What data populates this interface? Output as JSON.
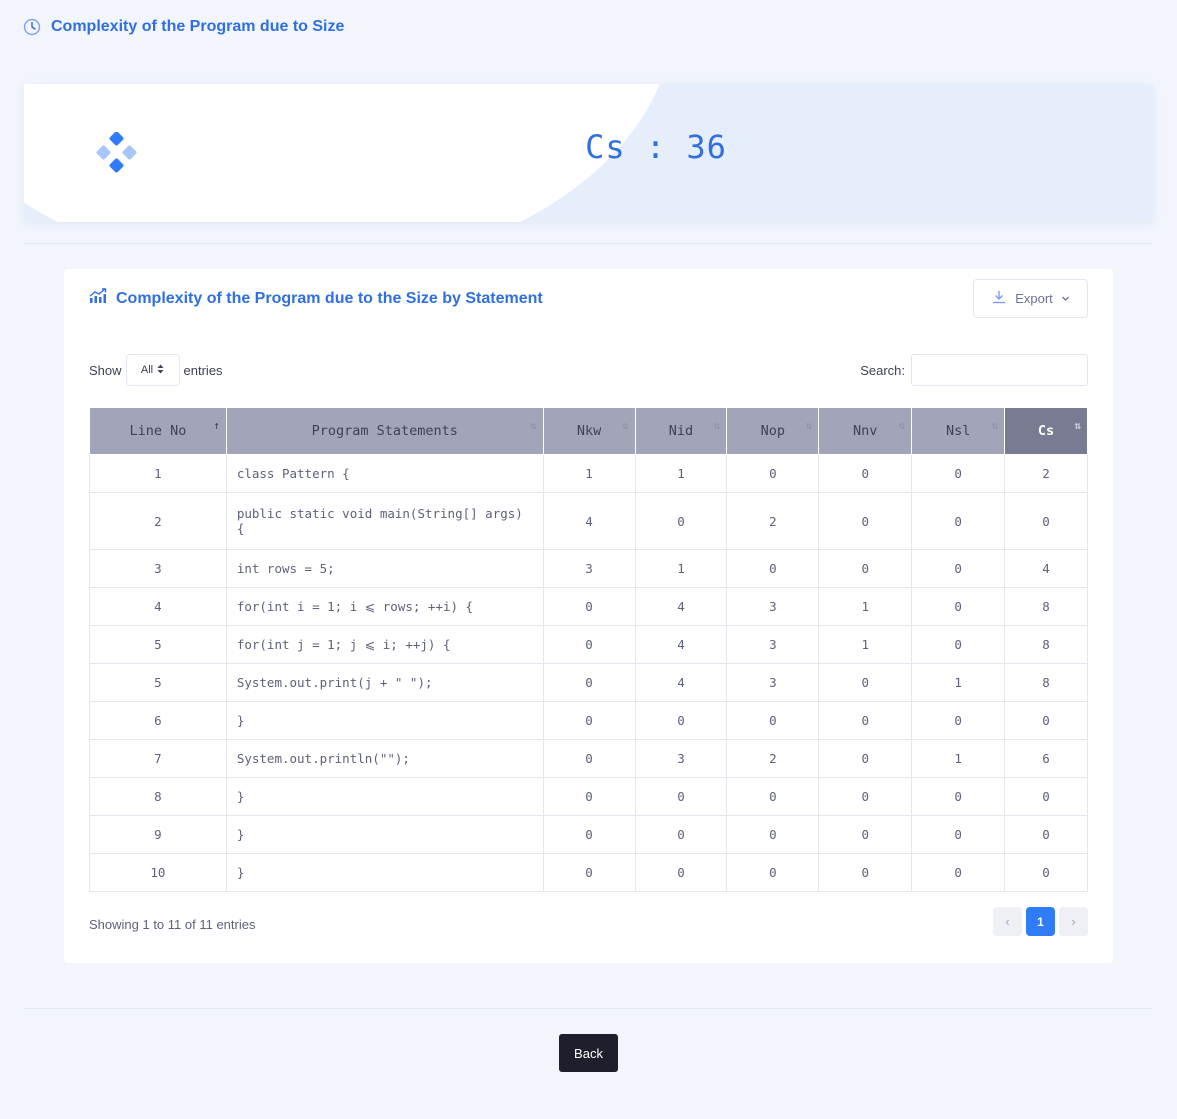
{
  "page": {
    "title": "Complexity of the Program due to Size"
  },
  "banner": {
    "metric_text": "Cs : 36"
  },
  "card": {
    "title": "Complexity of the Program due to the Size by Statement",
    "export_label": "Export",
    "length": {
      "prefix": "Show",
      "value": "All",
      "suffix": "entries"
    },
    "search": {
      "label": "Search:",
      "value": "",
      "placeholder": ""
    },
    "columns": [
      "Line No",
      "Program Statements",
      "Nkw",
      "Nid",
      "Nop",
      "Nnv",
      "Nsl",
      "Cs"
    ],
    "rows": [
      [
        "1",
        "class Pattern {",
        "1",
        "1",
        "0",
        "0",
        "0",
        "2"
      ],
      [
        "2",
        "public static void main(String[] args) {",
        "4",
        "0",
        "2",
        "0",
        "0",
        "0"
      ],
      [
        "3",
        "int rows = 5;",
        "3",
        "1",
        "0",
        "0",
        "0",
        "4"
      ],
      [
        "4",
        "for(int i = 1; i ⩽ rows; ++i) {",
        "0",
        "4",
        "3",
        "1",
        "0",
        "8"
      ],
      [
        "5",
        "for(int j = 1; j ⩽ i; ++j) {",
        "0",
        "4",
        "3",
        "1",
        "0",
        "8"
      ],
      [
        "5",
        "System.out.print(j + \" \");",
        "0",
        "4",
        "3",
        "0",
        "1",
        "8"
      ],
      [
        "6",
        "}",
        "0",
        "0",
        "0",
        "0",
        "0",
        "0"
      ],
      [
        "7",
        "System.out.println(\"\");",
        "0",
        "3",
        "2",
        "0",
        "1",
        "6"
      ],
      [
        "8",
        "}",
        "0",
        "0",
        "0",
        "0",
        "0",
        "0"
      ],
      [
        "9",
        "}",
        "0",
        "0",
        "0",
        "0",
        "0",
        "0"
      ],
      [
        "10",
        "}",
        "0",
        "0",
        "0",
        "0",
        "0",
        "0"
      ]
    ],
    "info": "Showing 1 to 11 of 11 entries",
    "pager": {
      "prev": "‹",
      "current": "1",
      "next": "›"
    }
  },
  "footer": {
    "back_label": "Back"
  },
  "colors": {
    "accent": "#2f6fe0",
    "header_bg": "#a2a5b9",
    "active_header_bg": "#787b91",
    "page_active": "#2f7cf6"
  }
}
